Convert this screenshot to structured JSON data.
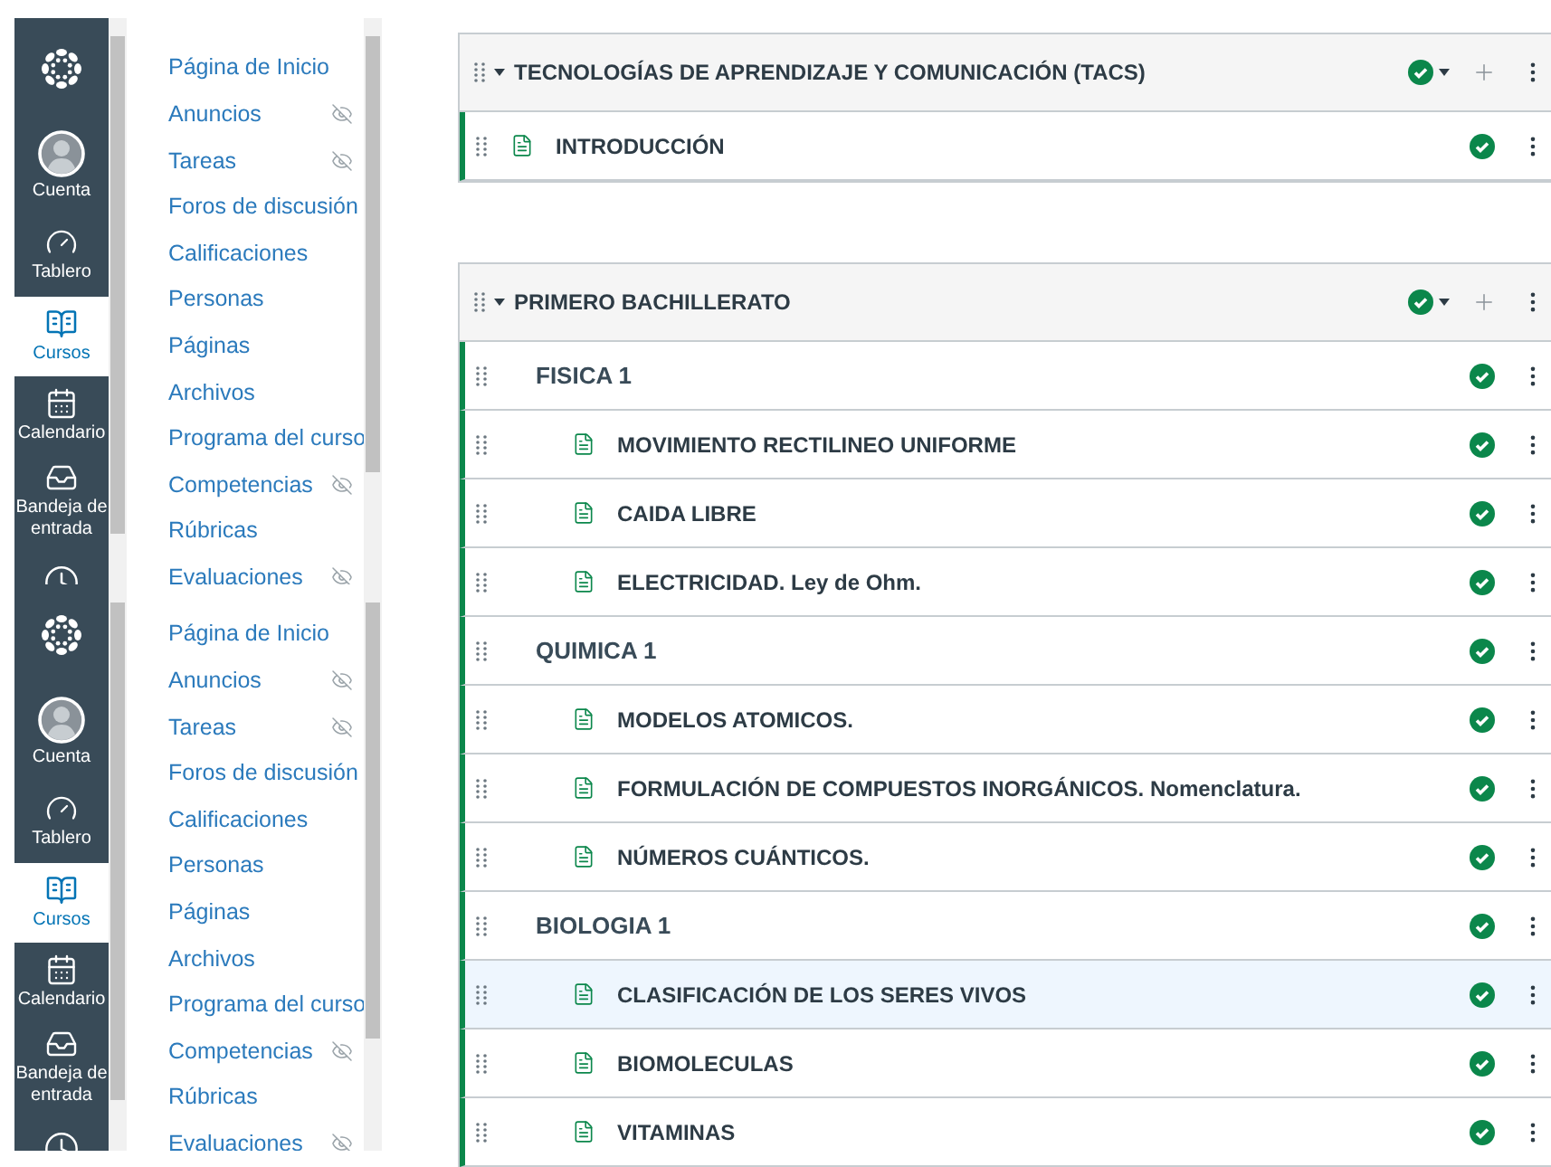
{
  "left_panels": [
    {
      "global_nav": [
        {
          "kind": "logo",
          "selected": false
        },
        {
          "kind": "account",
          "label": "Cuenta",
          "selected": false
        },
        {
          "kind": "dashboard",
          "label": "Tablero",
          "selected": false
        },
        {
          "kind": "courses",
          "label": "Cursos",
          "selected": true
        },
        {
          "kind": "calendar",
          "label": "Calendario",
          "selected": false
        },
        {
          "kind": "inbox",
          "label": "Bandeja de entrada",
          "selected": false
        },
        {
          "kind": "history",
          "selected": false
        }
      ],
      "course_nav": [
        {
          "label": "Página de Inicio",
          "hidden": false
        },
        {
          "label": "Anuncios",
          "hidden": true
        },
        {
          "label": "Tareas",
          "hidden": true
        },
        {
          "label": "Foros de discusión",
          "hidden": false
        },
        {
          "label": "Calificaciones",
          "hidden": false
        },
        {
          "label": "Personas",
          "hidden": false
        },
        {
          "label": "Páginas",
          "hidden": false
        },
        {
          "label": "Archivos",
          "hidden": false
        },
        {
          "label": "Programa del curso",
          "hidden": false
        },
        {
          "label": "Competencias",
          "hidden": true
        },
        {
          "label": "Rúbricas",
          "hidden": false
        },
        {
          "label": "Evaluaciones",
          "hidden": true
        }
      ]
    },
    {
      "global_nav": [
        {
          "kind": "logo",
          "selected": false
        },
        {
          "kind": "account",
          "label": "Cuenta",
          "selected": false
        },
        {
          "kind": "dashboard",
          "label": "Tablero",
          "selected": false
        },
        {
          "kind": "courses",
          "label": "Cursos",
          "selected": true
        },
        {
          "kind": "calendar",
          "label": "Calendario",
          "selected": false
        },
        {
          "kind": "inbox",
          "label": "Bandeja de entrada",
          "selected": false
        },
        {
          "kind": "history",
          "selected": false
        }
      ],
      "course_nav": [
        {
          "label": "Página de Inicio",
          "hidden": false
        },
        {
          "label": "Anuncios",
          "hidden": true
        },
        {
          "label": "Tareas",
          "hidden": true
        },
        {
          "label": "Foros de discusión",
          "hidden": false
        },
        {
          "label": "Calificaciones",
          "hidden": false
        },
        {
          "label": "Personas",
          "hidden": false
        },
        {
          "label": "Páginas",
          "hidden": false
        },
        {
          "label": "Archivos",
          "hidden": false
        },
        {
          "label": "Programa del curso",
          "hidden": false
        },
        {
          "label": "Competencias",
          "hidden": true
        },
        {
          "label": "Rúbricas",
          "hidden": false
        },
        {
          "label": "Evaluaciones",
          "hidden": true
        }
      ]
    }
  ],
  "modules": [
    {
      "title": "TECNOLOGÍAS DE APRENDIZAJE Y COMUNICACIÓN (TACS)",
      "published": true,
      "items": [
        {
          "kind": "page",
          "title": "INTRODUCCIÓN",
          "published": true,
          "selected": false
        }
      ]
    },
    {
      "title": "PRIMERO BACHILLERATO",
      "published": true,
      "items": [
        {
          "kind": "subheader",
          "title": "FISICA 1",
          "published": true,
          "selected": false,
          "children": [
            {
              "kind": "page",
              "title": "MOVIMIENTO RECTILINEO UNIFORME",
              "published": true,
              "selected": false
            },
            {
              "kind": "page",
              "title": "CAIDA LIBRE",
              "published": true,
              "selected": false
            },
            {
              "kind": "page",
              "title": "ELECTRICIDAD. Ley de Ohm.",
              "published": true,
              "selected": false
            }
          ]
        },
        {
          "kind": "subheader",
          "title": "QUIMICA 1",
          "published": true,
          "selected": false,
          "children": [
            {
              "kind": "page",
              "title": "MODELOS ATOMICOS.",
              "published": true,
              "selected": false
            },
            {
              "kind": "page",
              "title": "FORMULACIÓN DE COMPUESTOS INORGÁNICOS. Nomenclatura.",
              "published": true,
              "selected": false
            },
            {
              "kind": "page",
              "title": "NÚMEROS CUÁNTICOS.",
              "published": true,
              "selected": false
            }
          ]
        },
        {
          "kind": "subheader",
          "title": "BIOLOGIA 1",
          "published": true,
          "selected": false,
          "children": [
            {
              "kind": "page",
              "title": "CLASIFICACIÓN DE LOS SERES VIVOS",
              "published": true,
              "selected": true
            },
            {
              "kind": "page",
              "title": "BIOMOLECULAS",
              "published": true,
              "selected": false
            },
            {
              "kind": "page",
              "title": "VITAMINAS",
              "published": true,
              "selected": false
            }
          ]
        }
      ]
    }
  ]
}
